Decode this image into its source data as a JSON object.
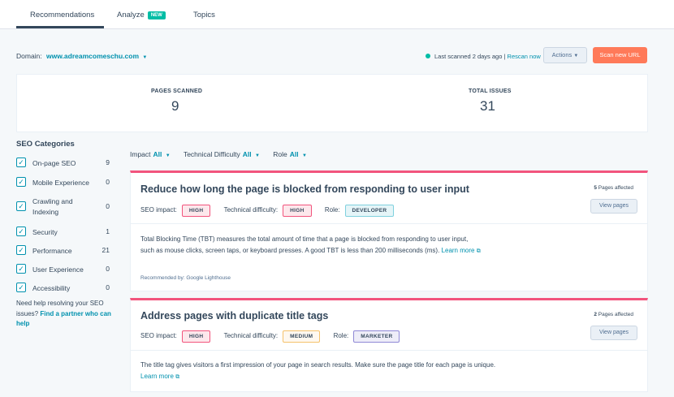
{
  "tabs": [
    {
      "label": "Recommendations"
    },
    {
      "label": "Analyze",
      "badge": "NEW"
    },
    {
      "label": "Topics"
    }
  ],
  "domain": {
    "label": "Domain:",
    "value": "www.adreamcomeschu.com"
  },
  "scan": {
    "status": "Last scanned 2 days ago |",
    "rescan": "Rescan now",
    "actions_label": "Actions",
    "scan_new_label": "Scan new URL"
  },
  "stats": [
    {
      "label": "PAGES SCANNED",
      "value": "9"
    },
    {
      "label": "TOTAL ISSUES",
      "value": "31"
    }
  ],
  "sidebar": {
    "title": "SEO Categories",
    "categories": [
      {
        "label": "On-page SEO",
        "count": "9"
      },
      {
        "label": "Mobile Experience",
        "count": "0"
      },
      {
        "label": "Crawling and Indexing",
        "count": "0"
      },
      {
        "label": "Security",
        "count": "1"
      },
      {
        "label": "Performance",
        "count": "21"
      },
      {
        "label": "User Experience",
        "count": "0"
      },
      {
        "label": "Accessibility",
        "count": "0"
      }
    ],
    "help_text": "Need help resolving your SEO issues?",
    "help_link": "Find a partner who can help"
  },
  "filters": [
    {
      "label": "Impact",
      "value": "All"
    },
    {
      "label": "Technical Difficulty",
      "value": "All"
    },
    {
      "label": "Role",
      "value": "All"
    }
  ],
  "cards": [
    {
      "title": "Reduce how long the page is blocked from responding to user input",
      "affected_count": "5",
      "affected_label": "Pages affected",
      "seo_impact_label": "SEO impact:",
      "seo_impact": "HIGH",
      "tech_label": "Technical difficulty:",
      "tech": "HIGH",
      "role_label": "Role:",
      "role": "DEVELOPER",
      "view_label": "View pages",
      "description": "Total Blocking Time (TBT) measures the total amount of time that a page is blocked from responding to user input, such as mouse clicks, screen taps, or keyboard presses. A good TBT is less than 200 milliseconds (ms).",
      "learn_more": "Learn more",
      "recommended_by": "Recommended by: Google Lighthouse"
    },
    {
      "title": "Address pages with duplicate title tags",
      "affected_count": "2",
      "affected_label": "Pages affected",
      "seo_impact_label": "SEO impact:",
      "seo_impact": "HIGH",
      "tech_label": "Technical difficulty:",
      "tech": "MEDIUM",
      "role_label": "Role:",
      "role": "MARKETER",
      "view_label": "View pages",
      "description": "The title tag gives visitors a first impression of your page in search results. Make sure the page title for each page is unique.",
      "learn_more": "Learn more"
    }
  ],
  "colors": {
    "accent": "#0091ae",
    "primary_button": "#ff7a59",
    "card_border": "#f2547d",
    "status_dot": "#00bda5"
  }
}
